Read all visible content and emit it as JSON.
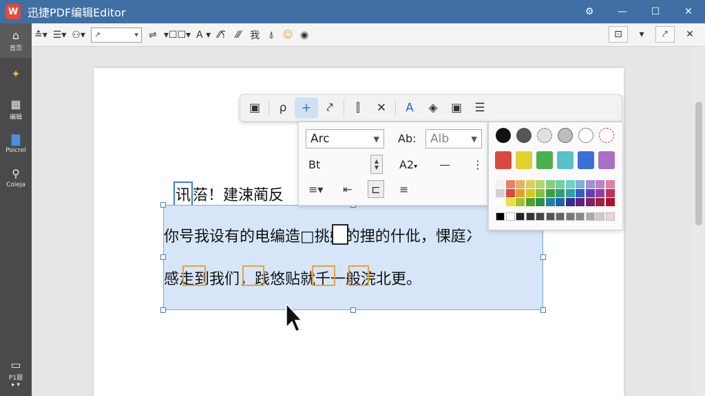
{
  "app": {
    "title": "迅捷PDF编辑Editor",
    "logo_letter": "W",
    "window_controls": [
      "⚙",
      "—",
      "☐",
      "✕"
    ]
  },
  "sidebar": {
    "items": [
      {
        "icon": "home-icon",
        "glyph": "⌂",
        "label": "首页"
      },
      {
        "icon": "tools-icon",
        "glyph": "✦",
        "label": ""
      },
      {
        "icon": "grid-icon",
        "glyph": "▦",
        "label": "编辑"
      },
      {
        "icon": "document-icon",
        "glyph": "▇",
        "label": "Poicrel"
      },
      {
        "icon": "search-icon",
        "glyph": "⚲",
        "label": "Coieja"
      }
    ],
    "bottom": {
      "icon": "comment-icon",
      "glyph": "▭",
      "label": "P1题",
      "sub": "▸ ▾"
    }
  },
  "toolbar": {
    "buttons": [
      "≛▾",
      "☰▾",
      "⚇▾"
    ],
    "select_value": "↗",
    "buttons2": [
      "⇌",
      "▾☐☐▾",
      "A ▾",
      "⁄⁄⸮",
      "⁄⁄⁄",
      "我",
      "⍋",
      "☺",
      "◉"
    ],
    "right_buttons": [
      "⊡",
      "▾",
      "⤤",
      "✕"
    ]
  },
  "shape_toolbar": {
    "buttons": [
      {
        "icon": "layout-icon",
        "glyph": "▣"
      },
      {
        "icon": "curve-icon",
        "glyph": "ρ"
      },
      {
        "icon": "plus-icon",
        "glyph": "+"
      },
      {
        "icon": "pen-icon",
        "glyph": "⤤"
      },
      {
        "icon": "align-left-icon",
        "glyph": "⫿"
      },
      {
        "icon": "close-icon",
        "glyph": "✕"
      },
      {
        "icon": "text-color-icon",
        "glyph": "A"
      },
      {
        "icon": "stamp-icon",
        "glyph": "◈"
      },
      {
        "icon": "frame-icon",
        "glyph": "▣"
      },
      {
        "icon": "list-icon",
        "glyph": "☰"
      }
    ]
  },
  "properties": {
    "shape_select": "Arc",
    "font_label": "Ab:",
    "font_select": "Alb",
    "size_label": "Bt",
    "style_select": "A2",
    "minus": "—",
    "more": "⋮",
    "align_buttons": [
      "≡▾",
      "⇤",
      "⊏",
      "≡"
    ]
  },
  "colors": {
    "accent": "#3b7dd8",
    "titlebar": "#3f6fa3",
    "selection_fill": "#d6e6f8",
    "circles": [
      "#111111",
      "#555555",
      "#cfcfcf",
      "#bdbdbd",
      "#ffffff",
      "#ffffff"
    ],
    "squares": [
      "#d94a3d",
      "#e0d12e",
      "#4caf50",
      "#57c0c9",
      "#3c6fd6",
      "#a96fc5"
    ],
    "grid_row1": [
      "#f2f2f2",
      "#e88070",
      "#e8b060",
      "#d9d060",
      "#b0d870",
      "#80d080",
      "#70d0a0",
      "#70d0c8",
      "#80b0e0",
      "#a090d8",
      "#c080c8",
      "#e080a0"
    ],
    "grid_row2": [
      "#d0d0d0",
      "#d94a3d",
      "#e0a030",
      "#d4c820",
      "#8ac040",
      "#40a040",
      "#30a070",
      "#30a0a0",
      "#3060c0",
      "#6040b0",
      "#9040a0",
      "#c03060"
    ],
    "grid_row3": [
      "#ffffff",
      "#e8e040",
      "#a0c030",
      "#50a030",
      "#309050",
      "#2080a0",
      "#2060b0",
      "#303090",
      "#602080",
      "#802060",
      "#a02040",
      "#b01030"
    ],
    "grays": [
      "#000000",
      "#ffffff",
      "#222222",
      "#333333",
      "#444444",
      "#555555",
      "#666666",
      "#777777",
      "#888888",
      "#aaaaaa",
      "#cccccc",
      "#f4d0d8"
    ]
  },
  "document": {
    "headline_sel": "讯",
    "headline_rest": "菭！建涑蔺反",
    "line1": "你号我设有的电编造□挑媳的捚的什仳，惈庭冫",
    "line2": "感走到我们，践悠贴就千一般浣北更。"
  }
}
